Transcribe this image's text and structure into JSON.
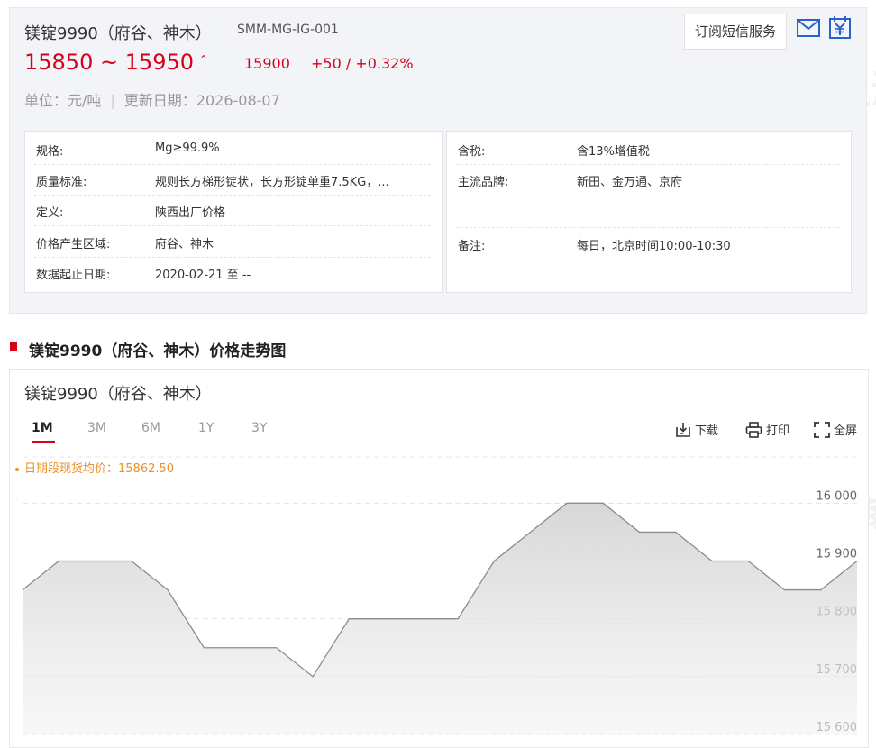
{
  "header": {
    "title": "镁锭9990（府谷、神木）",
    "code": "SMM-MG-IG-001",
    "price_range": "15850 ~ 15950",
    "price_arrow": "⌃",
    "avg_price": "15900",
    "change": "+50 / +0.32%",
    "unit_label": "单位：元/吨",
    "update_label": "更新日期：2026-08-07",
    "subscribe_label": "订阅短信服务"
  },
  "details_left": [
    {
      "k": "规格:",
      "v": "Mg≥99.9%"
    },
    {
      "k": "质量标准:",
      "v": "规则长方梯形锭状，长方形锭单重7.5KG，..."
    },
    {
      "k": "定义:",
      "v": "陕西出厂价格"
    },
    {
      "k": "价格产生区域:",
      "v": "府谷、神木"
    },
    {
      "k": "数据起止日期:",
      "v": "2020-02-21 至 --"
    }
  ],
  "details_right": [
    {
      "k": "含税:",
      "v": "含13%增值税"
    },
    {
      "k": "主流品牌:",
      "v": "新田、金万通、京府"
    },
    {
      "k": "备注:",
      "v": "每日，北京时间10:00-10:30"
    }
  ],
  "section_title": "镁锭9990（府谷、神木）价格走势图",
  "chart_panel": {
    "name": "镁锭9990（府谷、神木）",
    "tabs": [
      "1M",
      "3M",
      "6M",
      "1Y",
      "3Y"
    ],
    "active_tab": "1M",
    "tools": {
      "download": "下载",
      "print": "打印",
      "fullscreen": "全屏"
    },
    "avg_note": "日期段现货均价：15862.50"
  },
  "watermark": "SMM 上海有色网",
  "colors": {
    "accent": "#d9001b",
    "line": "#8c8c8c",
    "avg_note": "#e8912e"
  },
  "chart_data": {
    "type": "area",
    "series": [
      {
        "values": [
          15850,
          15900,
          15900,
          15900,
          15850,
          15750,
          15750,
          15750,
          15700,
          15800,
          15800,
          15800,
          15800,
          15900,
          15950,
          16000,
          16000,
          15950,
          15950,
          15900,
          15900,
          15850,
          15850,
          15900
        ]
      }
    ],
    "ylim": [
      15600,
      16000
    ],
    "y_ticks": [
      "16 000",
      "15 900",
      "15 800",
      "15 700",
      "15 600"
    ],
    "grid": true
  }
}
